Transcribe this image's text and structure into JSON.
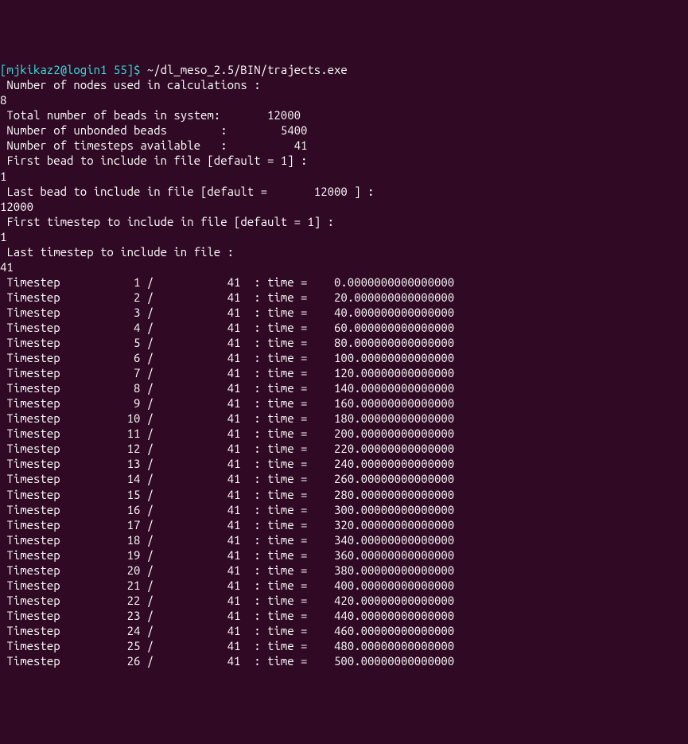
{
  "prompt": {
    "user_host": "[mjkikaz2@login1 55]$",
    "command": " ~/dl_meso_2.5/BIN/trajects.exe"
  },
  "header": {
    "nodes_label": " Number of nodes used in calculations :",
    "nodes_value": "8",
    "total_beads": " Total number of beads in system:       12000",
    "unbonded_beads": " Number of unbonded beads        :        5400",
    "timesteps_avail": " Number of timesteps available   :          41",
    "first_bead_prompt": " First bead to include in file [default = 1] :",
    "first_bead_value": "1",
    "last_bead_prompt": " Last bead to include in file [default =       12000 ] :",
    "last_bead_value": "12000",
    "first_ts_prompt": " First timestep to include in file [default = 1] :",
    "first_ts_value": "1",
    "last_ts_prompt": " Last timestep to include in file :",
    "last_ts_value": "41"
  },
  "timesteps": [
    {
      "line": " Timestep           1 /           41  : time =    0.0000000000000000"
    },
    {
      "line": " Timestep           2 /           41  : time =    20.000000000000000"
    },
    {
      "line": " Timestep           3 /           41  : time =    40.000000000000000"
    },
    {
      "line": " Timestep           4 /           41  : time =    60.000000000000000"
    },
    {
      "line": " Timestep           5 /           41  : time =    80.000000000000000"
    },
    {
      "line": " Timestep           6 /           41  : time =    100.00000000000000"
    },
    {
      "line": " Timestep           7 /           41  : time =    120.00000000000000"
    },
    {
      "line": " Timestep           8 /           41  : time =    140.00000000000000"
    },
    {
      "line": " Timestep           9 /           41  : time =    160.00000000000000"
    },
    {
      "line": " Timestep          10 /           41  : time =    180.00000000000000"
    },
    {
      "line": " Timestep          11 /           41  : time =    200.00000000000000"
    },
    {
      "line": " Timestep          12 /           41  : time =    220.00000000000000"
    },
    {
      "line": " Timestep          13 /           41  : time =    240.00000000000000"
    },
    {
      "line": " Timestep          14 /           41  : time =    260.00000000000000"
    },
    {
      "line": " Timestep          15 /           41  : time =    280.00000000000000"
    },
    {
      "line": " Timestep          16 /           41  : time =    300.00000000000000"
    },
    {
      "line": " Timestep          17 /           41  : time =    320.00000000000000"
    },
    {
      "line": " Timestep          18 /           41  : time =    340.00000000000000"
    },
    {
      "line": " Timestep          19 /           41  : time =    360.00000000000000"
    },
    {
      "line": " Timestep          20 /           41  : time =    380.00000000000000"
    },
    {
      "line": " Timestep          21 /           41  : time =    400.00000000000000"
    },
    {
      "line": " Timestep          22 /           41  : time =    420.00000000000000"
    },
    {
      "line": " Timestep          23 /           41  : time =    440.00000000000000"
    },
    {
      "line": " Timestep          24 /           41  : time =    460.00000000000000"
    },
    {
      "line": " Timestep          25 /           41  : time =    480.00000000000000"
    },
    {
      "line": " Timestep          26 /           41  : time =    500.00000000000000"
    }
  ]
}
